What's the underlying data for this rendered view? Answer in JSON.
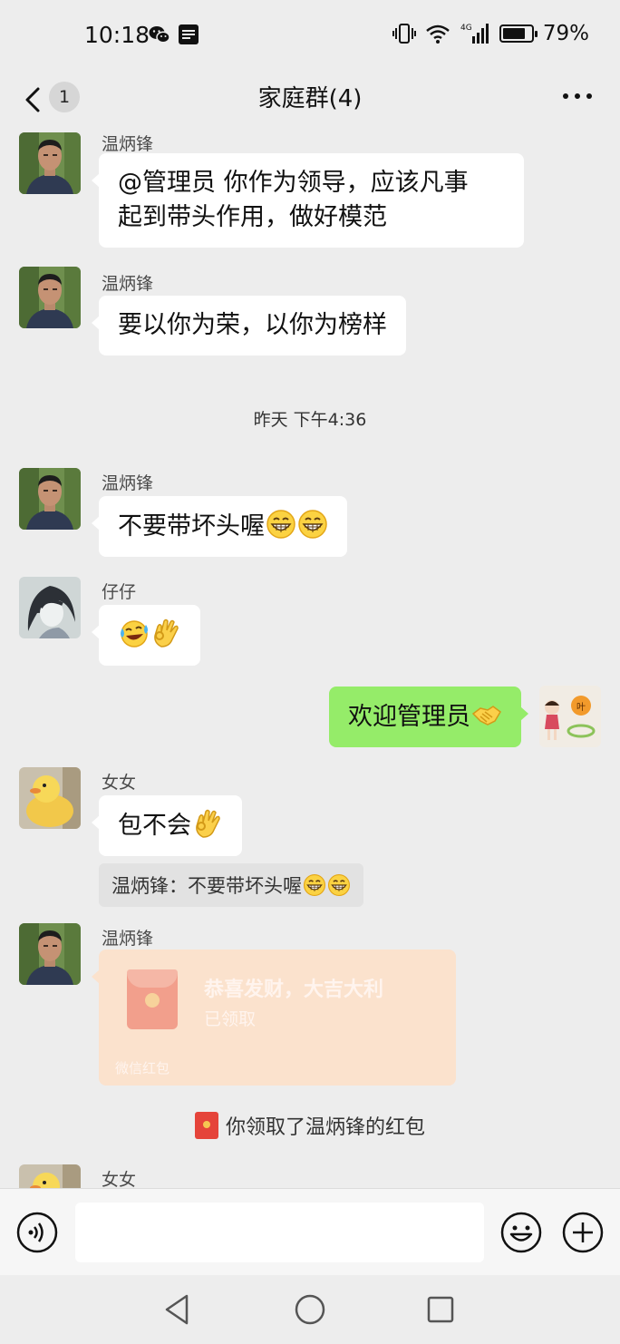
{
  "status_bar": {
    "time": "10:18",
    "battery": "79%",
    "battery_level": 0.79,
    "network": "4G"
  },
  "header": {
    "unread_count": "1",
    "title": "家庭群(4)"
  },
  "messages": [
    {
      "sender": "温炳锋",
      "lines": [
        "@管理员  你作为领导，应该凡事",
        "起到带头作用，做好模范"
      ]
    },
    {
      "sender": "温炳锋",
      "text": "要以你为荣，以你为榜样"
    },
    {
      "timestamp": "昨天 下午4:36"
    },
    {
      "sender": "温炳锋",
      "text": "不要带坏头喔",
      "emojis": [
        "grin-icon",
        "grin-icon"
      ]
    },
    {
      "sender": "仔仔",
      "emojis": [
        "laugh-cry-icon",
        "ok-hand-icon"
      ]
    },
    {
      "from_me": true,
      "text": "欢迎管理员",
      "emojis": [
        "handshake-icon"
      ]
    },
    {
      "sender": "女女",
      "text": "包不会",
      "emojis": [
        "ok-hand-icon"
      ]
    },
    {
      "quote": "温炳锋：不要带坏头喔",
      "emojis": [
        "grin-icon",
        "grin-icon"
      ]
    },
    {
      "sender": "温炳锋",
      "red_packet": {
        "title": "恭喜发财，大吉大利",
        "status": "已领取",
        "footer": "微信红包"
      }
    },
    {
      "system": "你领取了温炳锋的红包"
    },
    {
      "sender": "女女"
    }
  ]
}
